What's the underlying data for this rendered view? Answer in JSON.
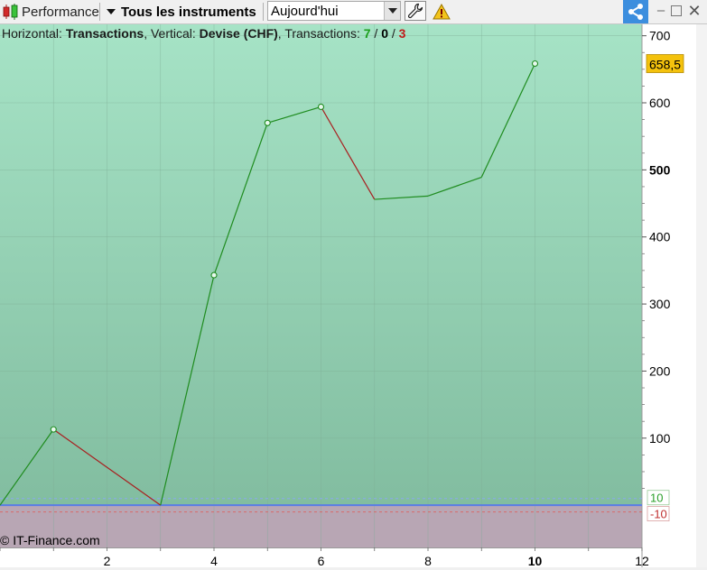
{
  "toolbar": {
    "performance_label": "Performance",
    "instruments_label": "Tous les instruments",
    "date_value": "Aujourd'hui",
    "icons": {
      "performance": "candlestick-icon",
      "settings": "wrench-icon",
      "warning": "warning-icon",
      "share": "share-icon",
      "minimize": "minimize-icon",
      "maximize": "maximize-icon",
      "close": "close-icon"
    }
  },
  "header": {
    "horizontal_prefix": "Horizontal: ",
    "horizontal_value": "Transactions",
    "vertical_prefix": ", Vertical: ",
    "vertical_value": "Devise (CHF)",
    "transactions_prefix": ", Transactions: ",
    "wins": "7",
    "sep1": " / ",
    "neutral": "0",
    "sep2": " / ",
    "losses": "3"
  },
  "copyright": "© IT-Finance.com",
  "colors": {
    "up": "#1f8c1f",
    "down": "#a82020",
    "bg_top": "#a6e3c6",
    "bg_bottom": "#82bda0",
    "neg_zone": "#b8a6b4",
    "zero_line": "#5a7de6",
    "last_label_bg": "#f4c20d"
  },
  "chart_data": {
    "type": "line",
    "x": [
      0,
      1,
      3,
      4,
      5,
      6,
      7,
      8,
      9,
      10
    ],
    "y": [
      0,
      113,
      0,
      343,
      570,
      594,
      456,
      461,
      489,
      658.5
    ],
    "markers_at_x": [
      1,
      4,
      5,
      6,
      10
    ],
    "xlim": [
      0,
      12
    ],
    "ylim": [
      -63,
      717
    ],
    "x_ticks": [
      {
        "v": 2,
        "label": "2"
      },
      {
        "v": 4,
        "label": "4"
      },
      {
        "v": 6,
        "label": "6"
      },
      {
        "v": 8,
        "label": "8"
      },
      {
        "v": 10,
        "label": "10",
        "bold": true
      },
      {
        "v": 12,
        "label": "12"
      }
    ],
    "y_ticks": [
      {
        "v": 100,
        "label": "100"
      },
      {
        "v": 200,
        "label": "200"
      },
      {
        "v": 300,
        "label": "300"
      },
      {
        "v": 400,
        "label": "400"
      },
      {
        "v": 500,
        "label": "500",
        "bold": true
      },
      {
        "v": 600,
        "label": "600"
      },
      {
        "v": 700,
        "label": "700"
      }
    ],
    "band_upper": {
      "v": 10,
      "label": "10"
    },
    "band_lower": {
      "v": -10,
      "label": "-10"
    },
    "last_value_label": "658,5",
    "last_value": 658.5,
    "xlabel": "Transactions",
    "ylabel": "Devise (CHF)"
  }
}
